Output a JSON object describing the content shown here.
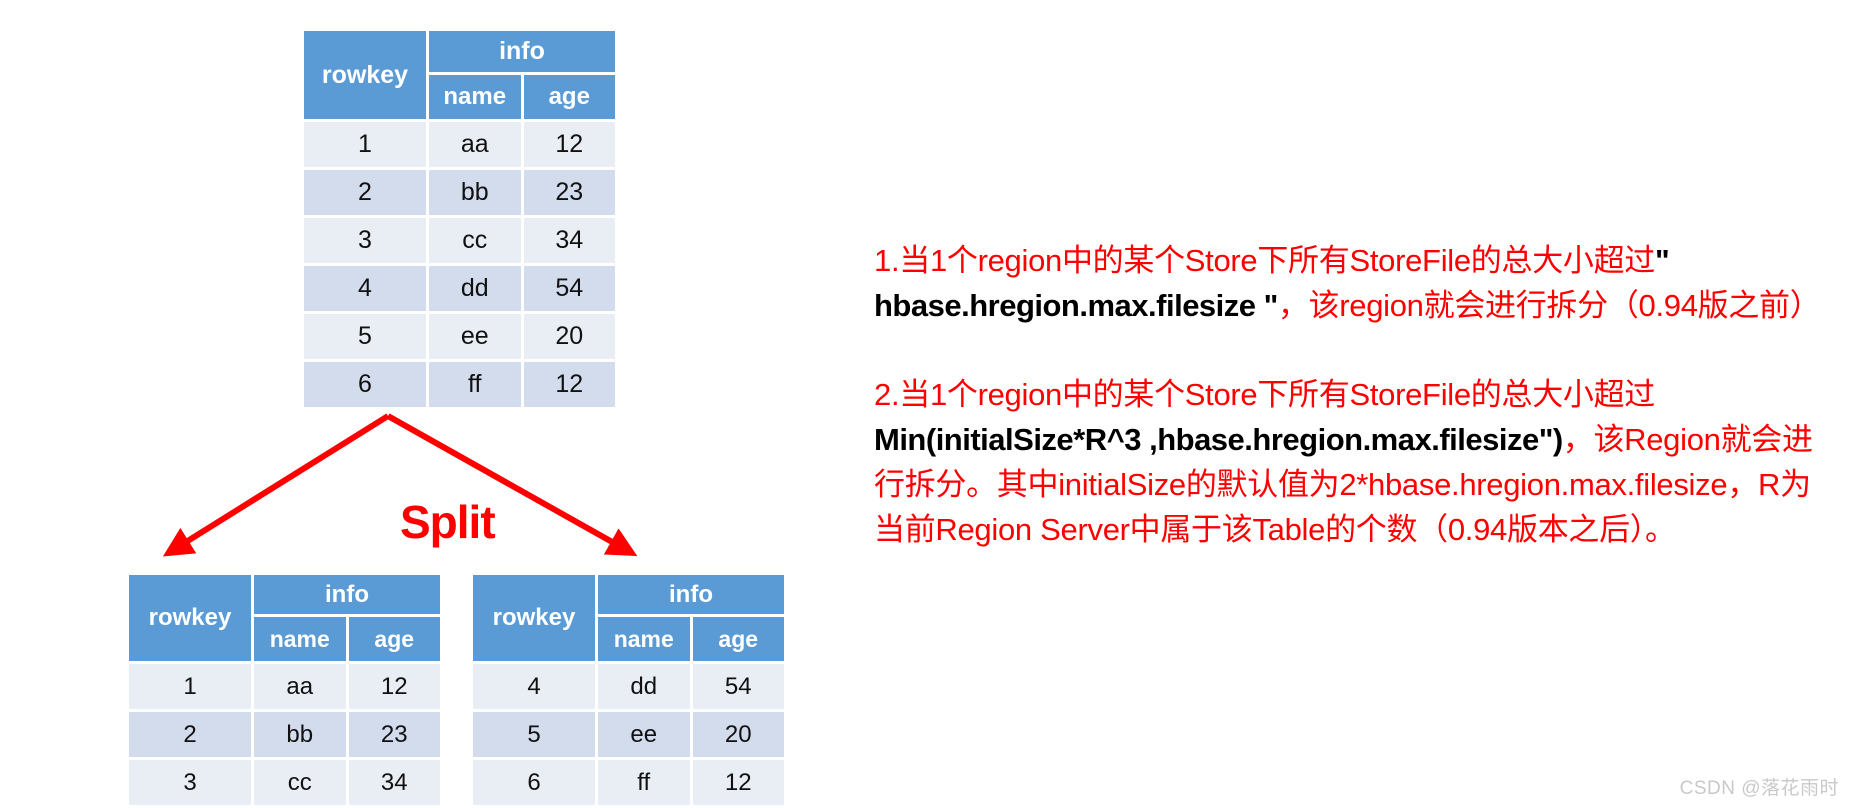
{
  "diagram": {
    "title_label": "Split",
    "arrow_color": "#ff0000",
    "header_color": "#5b9bd5",
    "row_light_color": "#e9edf4",
    "row_dark_color": "#d2dcec"
  },
  "parent_table": {
    "name": "parent-region-table",
    "headers": {
      "rowkey": "rowkey",
      "info": "info",
      "name": "name",
      "age": "age"
    },
    "rows": [
      {
        "rowkey": "1",
        "name": "aa",
        "age": "12"
      },
      {
        "rowkey": "2",
        "name": "bb",
        "age": "23"
      },
      {
        "rowkey": "3",
        "name": "cc",
        "age": "34"
      },
      {
        "rowkey": "4",
        "name": "dd",
        "age": "54"
      },
      {
        "rowkey": "5",
        "name": "ee",
        "age": "20"
      },
      {
        "rowkey": "6",
        "name": "ff",
        "age": "12"
      }
    ]
  },
  "child_table_left": {
    "name": "child-region-table-left",
    "headers": {
      "rowkey": "rowkey",
      "info": "info",
      "name": "name",
      "age": "age"
    },
    "rows": [
      {
        "rowkey": "1",
        "name": "aa",
        "age": "12"
      },
      {
        "rowkey": "2",
        "name": "bb",
        "age": "23"
      },
      {
        "rowkey": "3",
        "name": "cc",
        "age": "34"
      }
    ]
  },
  "child_table_right": {
    "name": "child-region-table-right",
    "headers": {
      "rowkey": "rowkey",
      "info": "info",
      "name": "name",
      "age": "age"
    },
    "rows": [
      {
        "rowkey": "4",
        "name": "dd",
        "age": "54"
      },
      {
        "rowkey": "5",
        "name": "ee",
        "age": "20"
      },
      {
        "rowkey": "6",
        "name": "ff",
        "age": "12"
      }
    ]
  },
  "notes": {
    "para1": {
      "part1": "1.当1个region中的某个Store下所有StoreFile的总大小超过",
      "emphasis": "\" hbase.hregion.max.filesize \"",
      "part2": "，该region就会进行拆分（0.94版之前）"
    },
    "para2": {
      "part1": "2.当1个region中的某个Store下所有StoreFile的总大小超过",
      "emphasis": "Min(initialSize*R^3 ,hbase.hregion.max.filesize\")",
      "part2": "，该Region就会进行拆分。其中initialSize的默认值为2*hbase.hregion.max.filesize，R为当前Region Server中属于该Table的个数（0.94版本之后）。"
    }
  },
  "watermark": {
    "text": "CSDN @落花雨时"
  }
}
